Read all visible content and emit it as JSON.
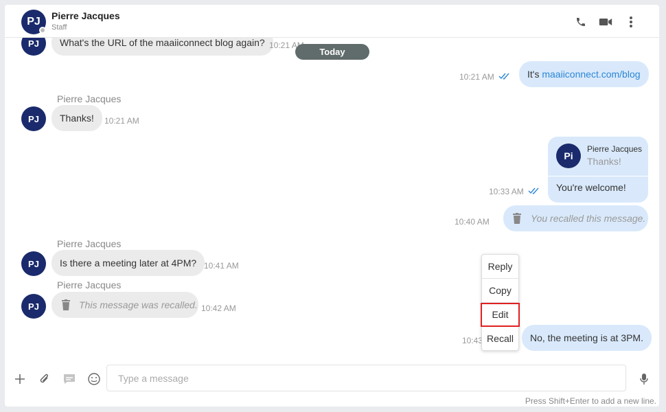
{
  "header": {
    "avatar_initials": "PJ",
    "name": "Pierre Jacques",
    "role": "Staff",
    "call_icon": "phone-icon",
    "video_icon": "video-camera-icon",
    "more_icon": "more-vertical-icon"
  },
  "date_divider": "Today",
  "messages": {
    "m1": {
      "avatar": "PJ",
      "text": "What's the URL of the maaiiconnect blog again?",
      "time": "10:21 AM"
    },
    "m2": {
      "prefix": "It's ",
      "link": "maaiiconnect.com/blog",
      "time": "10:21 AM"
    },
    "m3": {
      "sender": "Pierre Jacques",
      "avatar": "PJ",
      "text": "Thanks!",
      "time": "10:21 AM"
    },
    "m4": {
      "quote_avatar": "Pi",
      "quote_sender": "Pierre Jacques",
      "quote_text": "Thanks!",
      "text": "You're welcome!",
      "time": "10:33 AM"
    },
    "m5": {
      "text": "You recalled this message.",
      "time": "10:40 AM"
    },
    "m6": {
      "sender": "Pierre Jacques",
      "avatar": "PJ",
      "text": "Is there a meeting later at 4PM?",
      "time": "10:41 AM"
    },
    "m7": {
      "sender": "Pierre Jacques",
      "avatar": "PJ",
      "text": "This message was recalled.",
      "time": "10:42 AM"
    },
    "m8": {
      "text": "No, the meeting is at 3PM.",
      "time": "10:43"
    }
  },
  "context_menu": {
    "reply": "Reply",
    "copy": "Copy",
    "edit": "Edit",
    "recall": "Recall"
  },
  "composer": {
    "placeholder": "Type a message",
    "hint": "Press Shift+Enter to add a new line."
  },
  "colors": {
    "avatar": "#1a2a6c",
    "incoming_bubble": "#ebebeb",
    "outgoing_bubble": "#d9e9fb",
    "link": "#2b86d6",
    "today_pill": "#606b6b",
    "highlight": "#e02020"
  }
}
